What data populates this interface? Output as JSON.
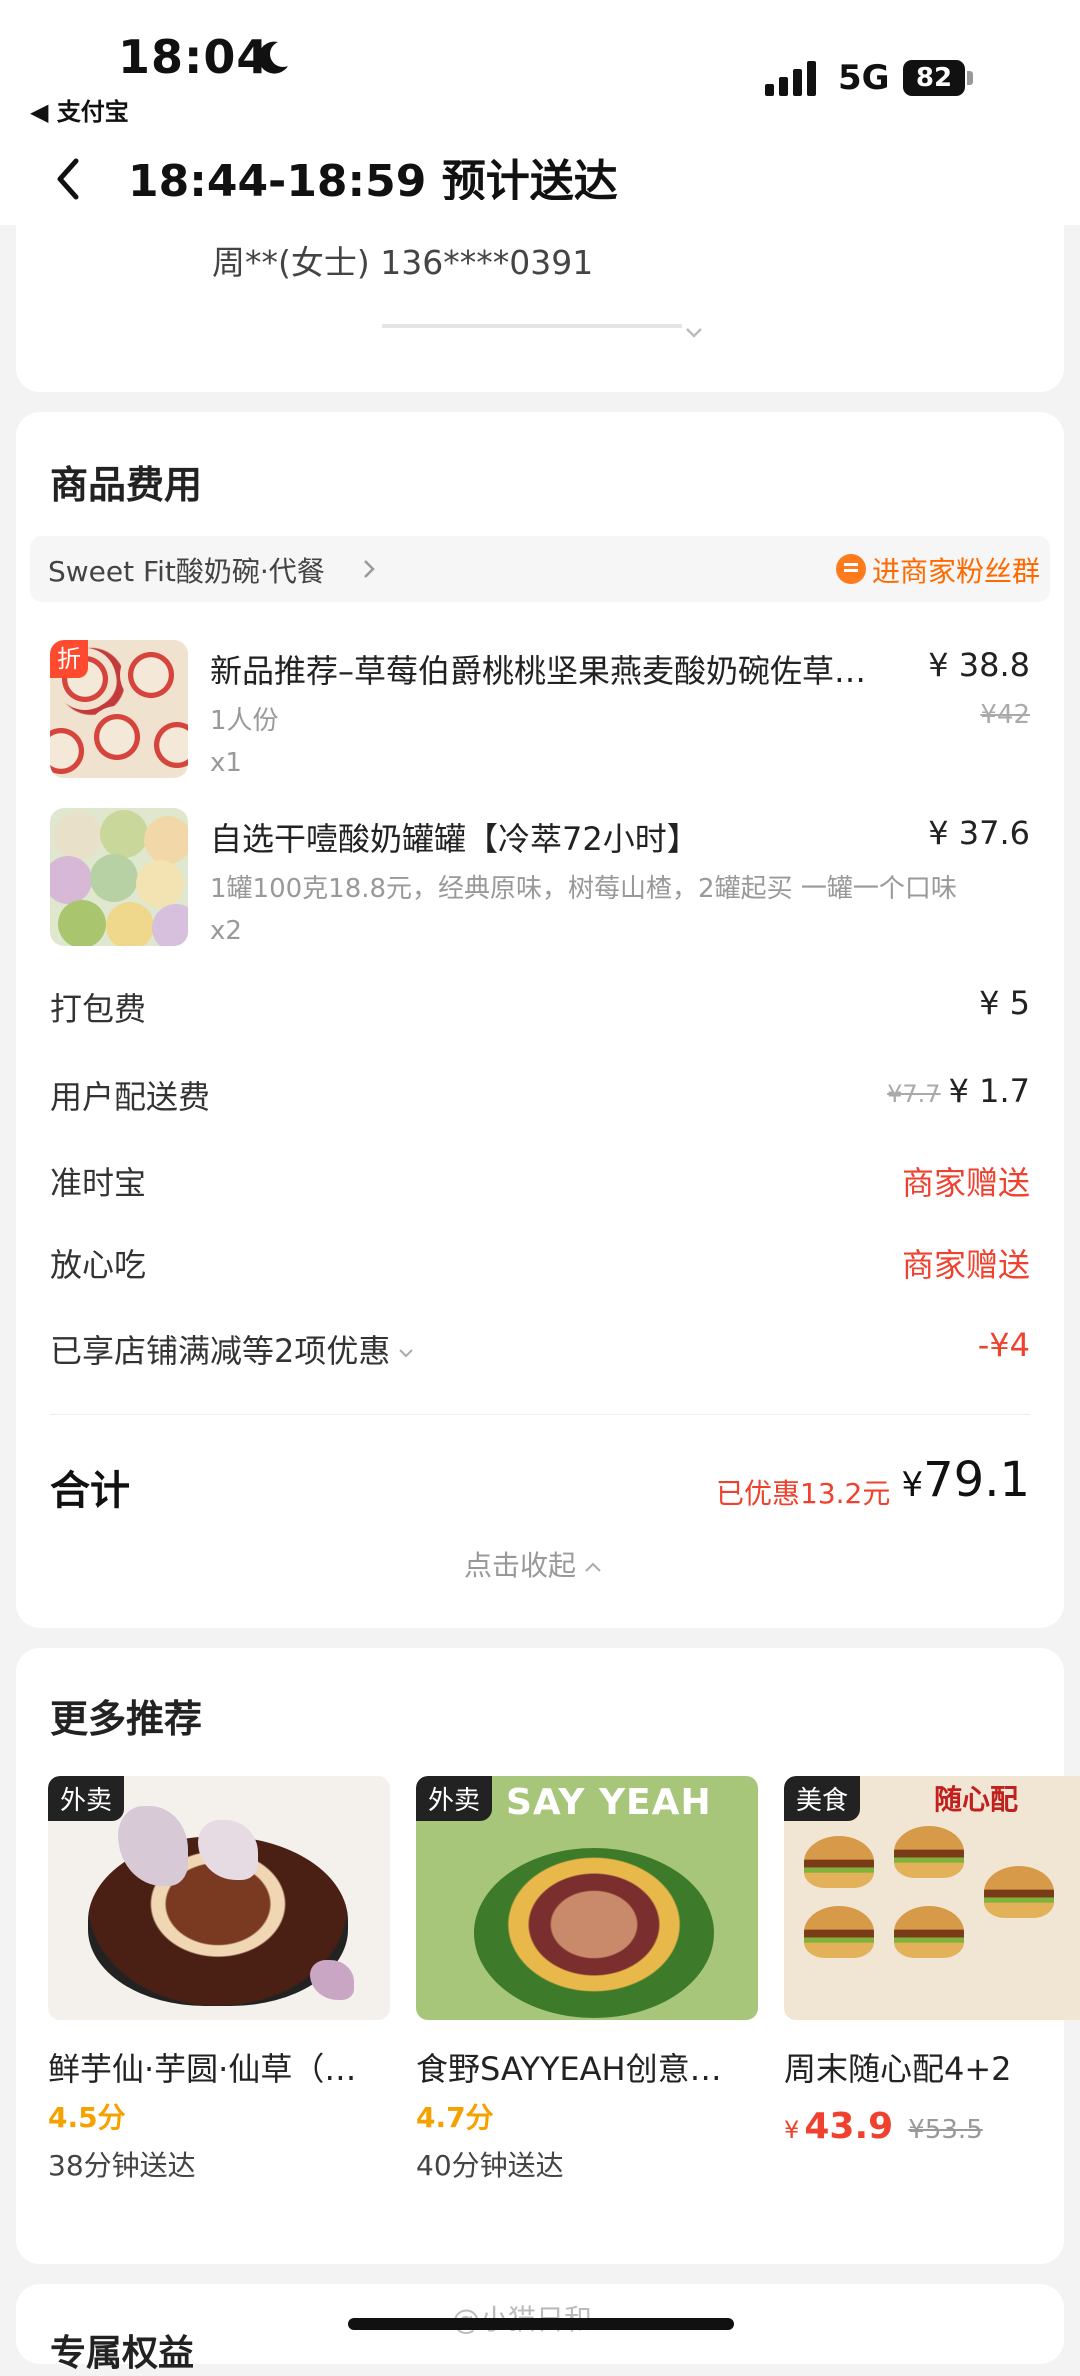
{
  "status_bar": {
    "time": "18:04",
    "back_app": "◀ 支付宝",
    "network": "5G",
    "battery": "82"
  },
  "nav": {
    "title": "18:44-18:59 预计送达"
  },
  "address": {
    "contact": "周**(女士) 136****0391"
  },
  "fees": {
    "section_title": "商品费用",
    "shop_name": "Sweet Fit酸奶碗·代餐",
    "fan_group": "进商家粉丝群",
    "items": [
      {
        "tag": "折",
        "name": "新品推荐–草莓伯爵桃桃坚果燕麦酸奶碗佐草…",
        "spec": "1人份",
        "qty": "x1",
        "price": "¥ 38.8",
        "orig_price": "¥42"
      },
      {
        "name": "自选干噎酸奶罐罐【冷萃72小时】",
        "spec": "1罐100克18.8元，经典原味，树莓山楂，2罐起买 一罐一个口味",
        "qty": "x2",
        "price": "¥ 37.6"
      }
    ],
    "rows": {
      "packing_label": "打包费",
      "packing_value": "¥ 5",
      "delivery_label": "用户配送费",
      "delivery_orig": "¥7.7",
      "delivery_value": "¥ 1.7",
      "ontime_label": "准时宝",
      "ontime_value": "商家赠送",
      "safe_label": "放心吃",
      "safe_value": "商家赠送",
      "discount_label": "已享店铺满减等2项优惠",
      "discount_value": "-¥4"
    },
    "total_label": "合计",
    "total_discount": "已优惠13.2元",
    "total_yen": "¥",
    "total_value": "79.1",
    "collapse": "点击收起"
  },
  "recommend": {
    "title": "更多推荐",
    "items": [
      {
        "tag": "外卖",
        "name": "鲜芋仙·芋圆·仙草（…",
        "score": "4.5分",
        "eta": "38分钟送达"
      },
      {
        "tag": "外卖",
        "name": "食野SAYYEAH创意…",
        "score": "4.7分",
        "eta": "40分钟送达",
        "img_text": "SAY YEAH"
      },
      {
        "tag": "美食",
        "name": "周末随心配4+2",
        "price_yen": "¥",
        "price": "43.9",
        "orig_price": "¥53.5",
        "img_text": "随心配"
      }
    ]
  },
  "next_section": {
    "title": "专属权益"
  },
  "watermark": "@小猫日和",
  "colors": {
    "accent_red": "#f0402e",
    "accent_orange": "#ff6a00",
    "score_yellow": "#f5a100",
    "background": "#f3f3f3"
  }
}
